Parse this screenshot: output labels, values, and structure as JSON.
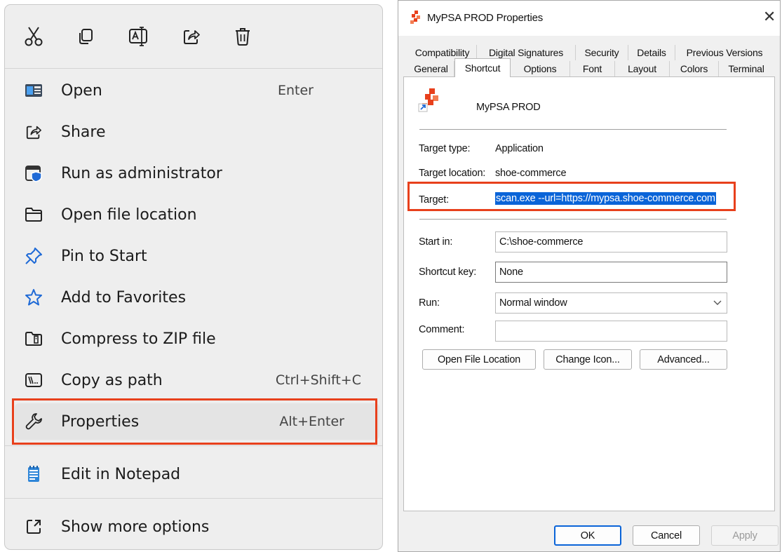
{
  "context_menu": {
    "toolbar": [
      {
        "name": "cut-icon"
      },
      {
        "name": "copy-icon"
      },
      {
        "name": "rename-icon"
      },
      {
        "name": "share-icon"
      },
      {
        "name": "delete-icon"
      }
    ],
    "items": [
      {
        "label": "Open",
        "shortcut": "Enter",
        "icon": "open-app-icon"
      },
      {
        "label": "Share",
        "shortcut": "",
        "icon": "share-icon"
      },
      {
        "label": "Run as administrator",
        "shortcut": "",
        "icon": "shield-window-icon"
      },
      {
        "label": "Open file location",
        "shortcut": "",
        "icon": "folder-icon"
      },
      {
        "label": "Pin to Start",
        "shortcut": "",
        "icon": "pin-icon"
      },
      {
        "label": "Add to Favorites",
        "shortcut": "",
        "icon": "star-icon"
      },
      {
        "label": "Compress to ZIP file",
        "shortcut": "",
        "icon": "zip-folder-icon"
      },
      {
        "label": "Copy as path",
        "shortcut": "Ctrl+Shift+C",
        "icon": "path-icon"
      },
      {
        "label": "Properties",
        "shortcut": "Alt+Enter",
        "icon": "wrench-icon"
      },
      {
        "label": "Edit in Notepad",
        "shortcut": "",
        "icon": "notepad-icon"
      },
      {
        "label": "Show more options",
        "shortcut": "",
        "icon": "more-options-icon"
      }
    ],
    "highlight_color": "#e8401c"
  },
  "dialog": {
    "title": "MyPSA PROD Properties",
    "close": "✕",
    "tabs_row1": [
      "Compatibility",
      "Digital Signatures",
      "Security",
      "Details",
      "Previous Versions"
    ],
    "tabs_row2": [
      "General",
      "Shortcut",
      "Options",
      "Font",
      "Layout",
      "Colors",
      "Terminal"
    ],
    "active_tab": "Shortcut",
    "app_name": "MyPSA PROD",
    "target_type_label": "Target type:",
    "target_type_value": "Application",
    "target_location_label": "Target location:",
    "target_location_value": "shoe-commerce",
    "target_label": "Target:",
    "target_value": "scan.exe --url=https://mypsa.shoe-commerce.com",
    "start_in_label": "Start in:",
    "start_in_value": "C:\\shoe-commerce",
    "shortcut_key_label": "Shortcut key:",
    "shortcut_key_value": "None",
    "run_label": "Run:",
    "run_value": "Normal window",
    "comment_label": "Comment:",
    "comment_value": "",
    "buttons": {
      "open_file_location": "Open File Location",
      "change_icon": "Change Icon...",
      "advanced": "Advanced...",
      "ok": "OK",
      "cancel": "Cancel",
      "apply": "Apply"
    },
    "selection_color": "#0a64d8"
  }
}
